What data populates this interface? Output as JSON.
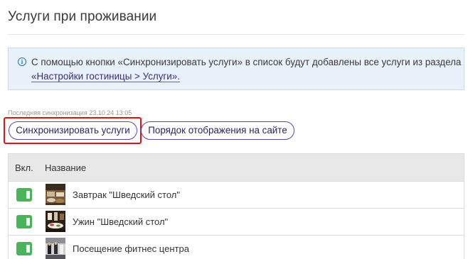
{
  "page": {
    "title": "Услуги при проживании"
  },
  "info": {
    "icon": "info-circle-icon",
    "text": "С помощью кнопки «Синхронизировать услуги» в список будут добавлены все услуги из раздела",
    "link_text": "«Настройки гостиницы > Услуги»."
  },
  "sync": {
    "last_sync": "Последняя синхронизация 23.10.24 13:05"
  },
  "buttons": {
    "sync_label": "Синхронизировать услуги",
    "order_label": "Порядок отображения на сайте"
  },
  "table": {
    "headers": {
      "enabled": "Вкл.",
      "name": "Название"
    },
    "rows": [
      {
        "name": "Завтрак \"Шведский стол\"",
        "enabled": true,
        "thumb": "breakfast-photo"
      },
      {
        "name": "Ужин \"Шведский стол\"",
        "enabled": true,
        "thumb": "dinner-photo"
      },
      {
        "name": "Посещение фитнес центра",
        "enabled": true,
        "thumb": "fitness-photo"
      }
    ]
  },
  "colors": {
    "accent": "#5a4ba8",
    "highlight": "#e31212",
    "toggle_on": "#49b45a",
    "info_bg": "#e9f2fa"
  }
}
